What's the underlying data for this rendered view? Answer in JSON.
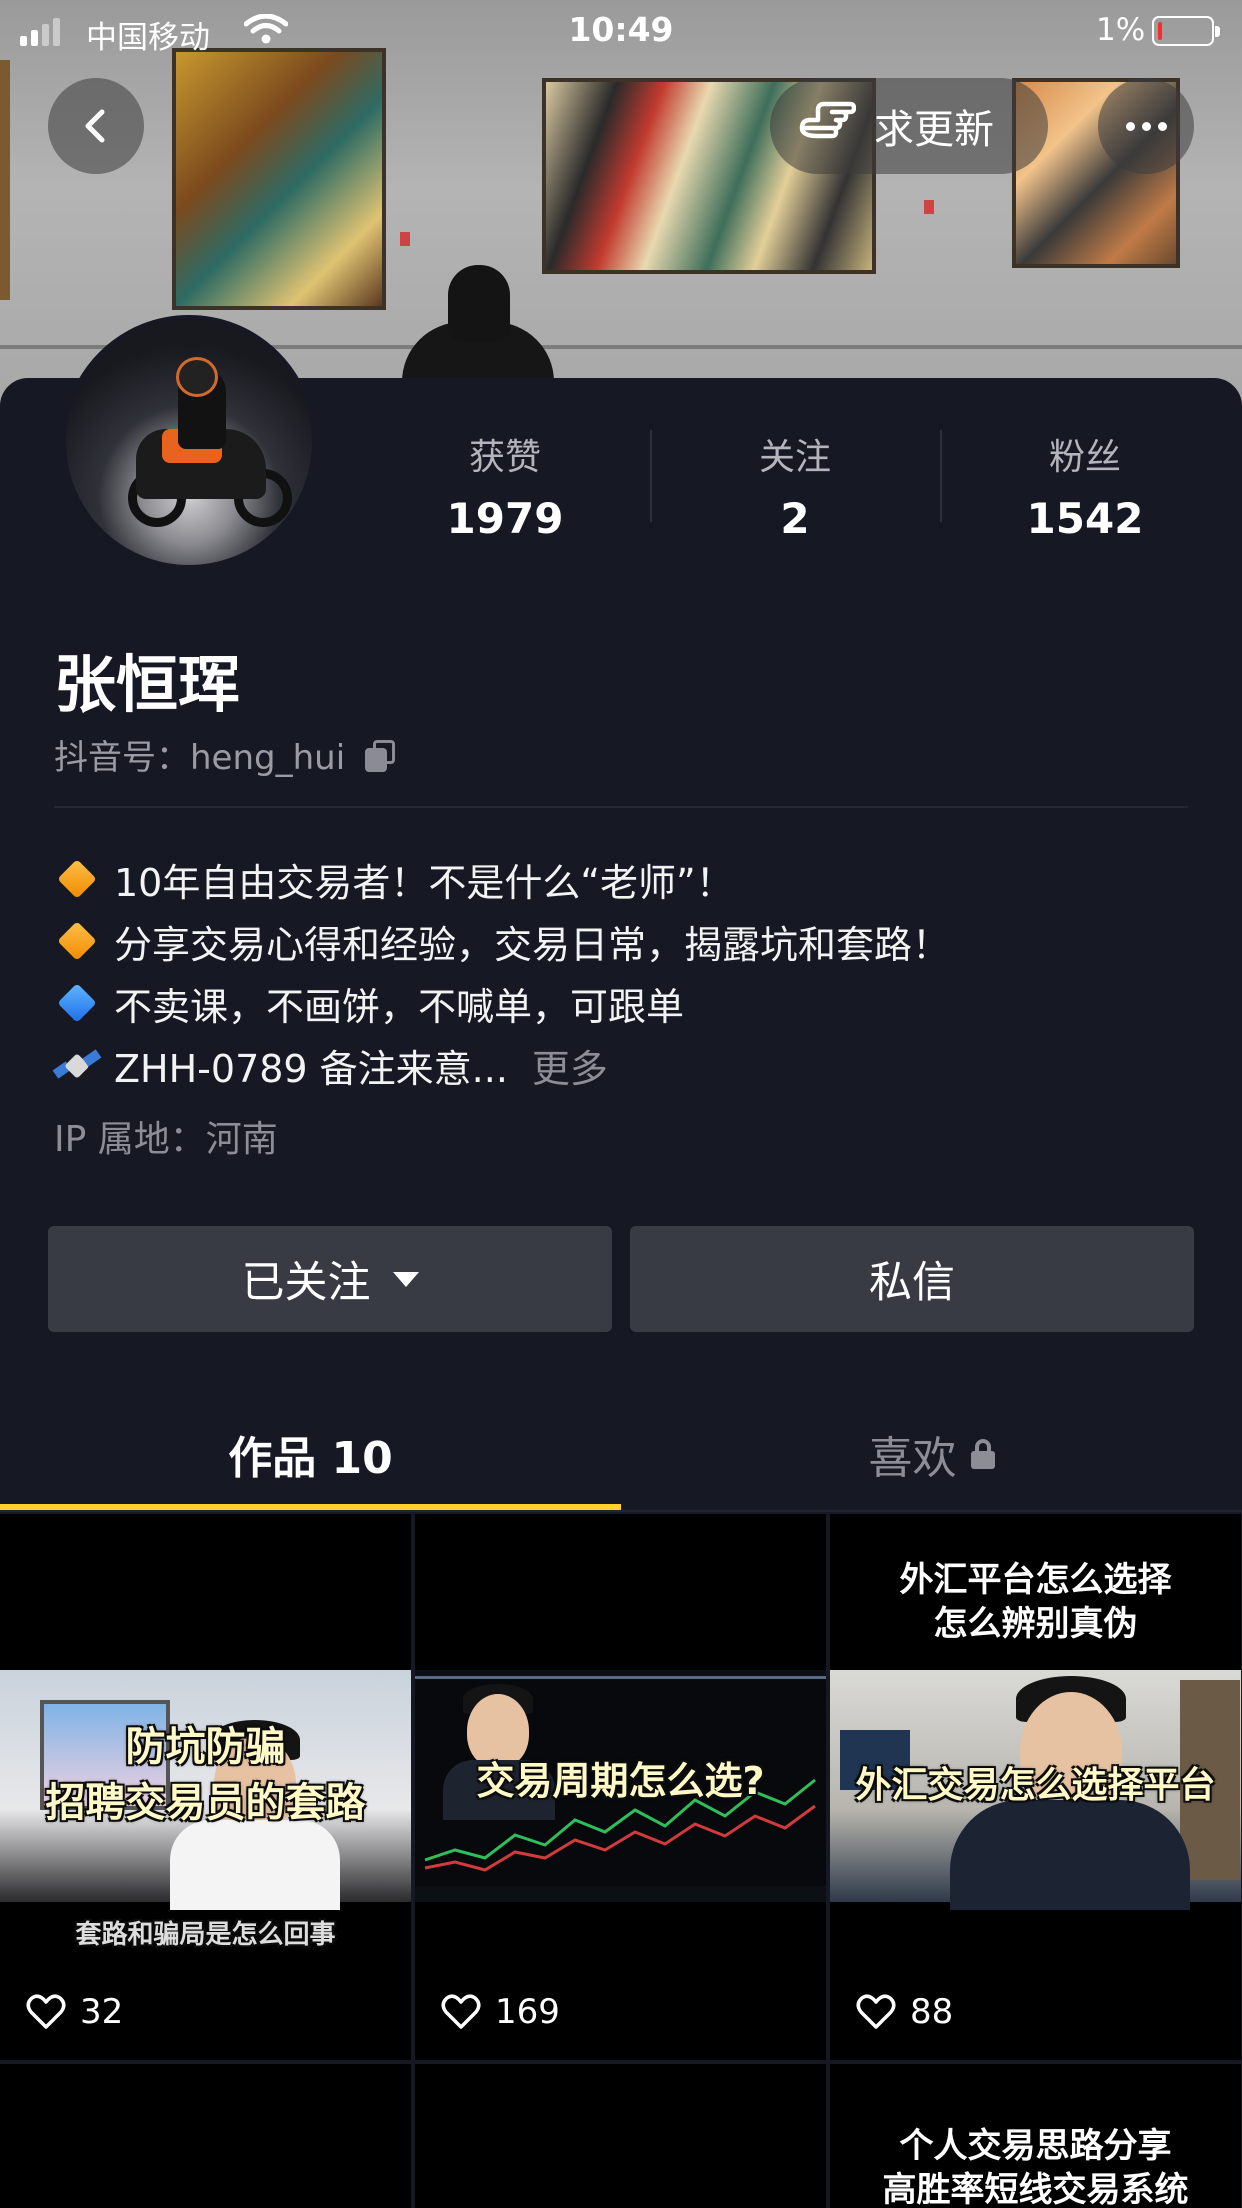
{
  "status_bar": {
    "carrier": "中国移动",
    "time": "10:49",
    "battery_percent": "1%",
    "battery_color": "#ff2b2b"
  },
  "nav": {
    "back_icon": "chevron-left-icon",
    "update_label": "求更新",
    "update_icon": "pointing-hand-icon",
    "more_icon": "ellipsis-icon"
  },
  "profile": {
    "stats": [
      {
        "label": "获赞",
        "value": "1979"
      },
      {
        "label": "关注",
        "value": "2"
      },
      {
        "label": "粉丝",
        "value": "1542"
      }
    ],
    "name": "张恒珲",
    "handle": "抖音号：heng_hui",
    "bio": [
      {
        "icon": "orange-diamond-icon",
        "text": "10年自由交易者！不是什么“老师”！"
      },
      {
        "icon": "orange-diamond-icon",
        "text": "分享交易心得和经验，交易日常，揭露坑和套路！"
      },
      {
        "icon": "blue-diamond-icon",
        "text": "不卖课，不画饼，不喊单，可跟单"
      },
      {
        "icon": "satellite-icon",
        "text": "ZHH-0789 备注来意..."
      }
    ],
    "bio_more": "更多",
    "ip_location": "IP 属地：河南"
  },
  "actions": {
    "follow_label": "已关注",
    "message_label": "私信"
  },
  "tabs": {
    "works_label": "作品 10",
    "likes_label": "喜欢",
    "accent": "#fdd230"
  },
  "videos": [
    {
      "top_caption": "",
      "caption_1": "防坑防骗",
      "caption_2": "招聘交易员的套路",
      "caption_3": "套路和骗局是怎么回事",
      "likes": "32"
    },
    {
      "top_caption": "",
      "caption_1": "交易周期怎么选?",
      "likes": "169"
    },
    {
      "top_caption_1": "外汇平台怎么选择",
      "top_caption_2": "怎么辨别真伪",
      "caption_1": "外汇交易怎么选择平台",
      "likes": "88"
    },
    {
      "top_caption": ""
    },
    {
      "top_caption": ""
    },
    {
      "top_caption_1": "个人交易思路分享",
      "top_caption_2": "高胜率短线交易系统"
    }
  ]
}
